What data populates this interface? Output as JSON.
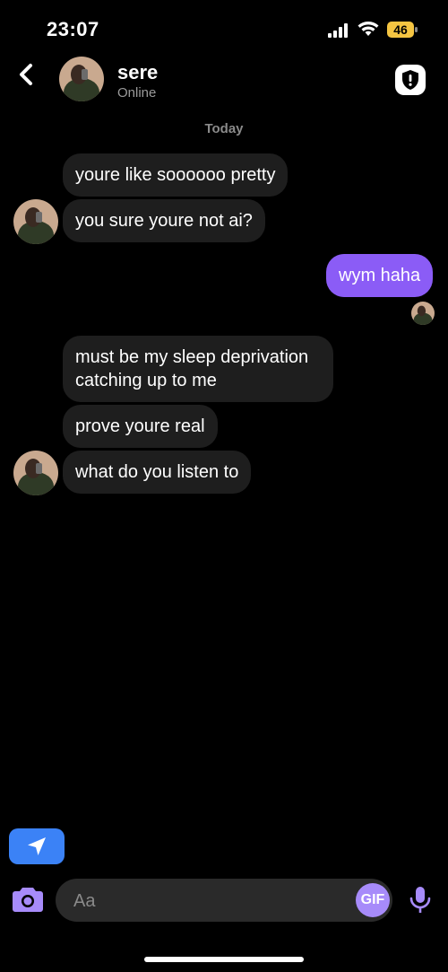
{
  "status_bar": {
    "time": "23:07",
    "battery": "46",
    "battery_color": "#f5c542"
  },
  "header": {
    "name": "sere",
    "status": "Online"
  },
  "date_label": "Today",
  "messages": [
    {
      "text": "youre like soooooo pretty",
      "direction": "incoming"
    },
    {
      "text": "you sure youre not ai?",
      "direction": "incoming"
    },
    {
      "text": "wym haha",
      "direction": "outgoing"
    },
    {
      "text": "must be my sleep deprivation catching up to me",
      "direction": "incoming"
    },
    {
      "text": "prove youre real",
      "direction": "incoming"
    },
    {
      "text": "what do you listen to",
      "direction": "incoming"
    }
  ],
  "composer": {
    "placeholder": "Aa",
    "gif_label": "GIF"
  },
  "colors": {
    "outgoing_bubble": "#8b5cf6",
    "incoming_bubble": "#1e1e1e",
    "accent": "#a78bfa",
    "location_button": "#3b82f6"
  },
  "icons": {
    "back": "chevron-left-icon",
    "safety": "shield-alert-icon",
    "location": "send-location-icon",
    "camera": "camera-icon",
    "mic": "microphone-icon"
  }
}
